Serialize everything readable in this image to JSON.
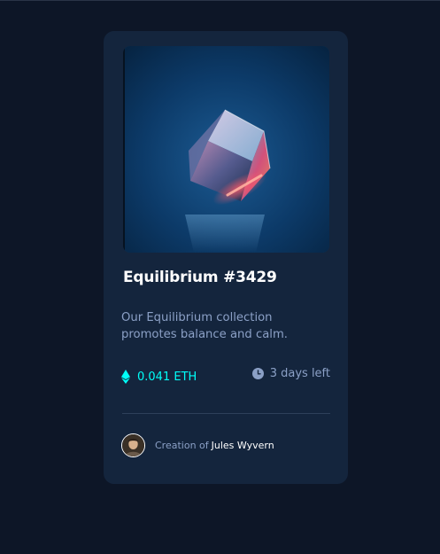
{
  "card": {
    "title": "Equilibrium #3429",
    "description": "Our Equilibrium collection promotes balance and calm.",
    "price": "0.041 ETH",
    "time_left": "3 days left",
    "creation_label": "Creation of",
    "creator_name": "Jules Wyvern"
  },
  "icons": {
    "price": "ethereum-icon",
    "time": "clock-icon"
  },
  "colors": {
    "page_background": "#0d1627",
    "card_background": "#14253d",
    "accent": "#00fff8",
    "muted_text": "#8ba0c6",
    "heading": "#ffffff",
    "divider": "#2e405a"
  }
}
